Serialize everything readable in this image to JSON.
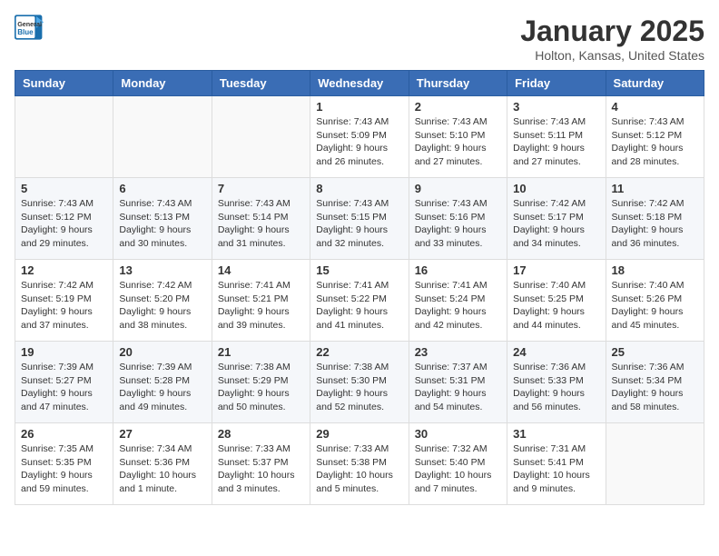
{
  "logo": {
    "line1": "General",
    "line2": "Blue"
  },
  "title": "January 2025",
  "subtitle": "Holton, Kansas, United States",
  "headers": [
    "Sunday",
    "Monday",
    "Tuesday",
    "Wednesday",
    "Thursday",
    "Friday",
    "Saturday"
  ],
  "weeks": [
    [
      {
        "day": "",
        "detail": ""
      },
      {
        "day": "",
        "detail": ""
      },
      {
        "day": "",
        "detail": ""
      },
      {
        "day": "1",
        "detail": "Sunrise: 7:43 AM\nSunset: 5:09 PM\nDaylight: 9 hours and 26 minutes."
      },
      {
        "day": "2",
        "detail": "Sunrise: 7:43 AM\nSunset: 5:10 PM\nDaylight: 9 hours and 27 minutes."
      },
      {
        "day": "3",
        "detail": "Sunrise: 7:43 AM\nSunset: 5:11 PM\nDaylight: 9 hours and 27 minutes."
      },
      {
        "day": "4",
        "detail": "Sunrise: 7:43 AM\nSunset: 5:12 PM\nDaylight: 9 hours and 28 minutes."
      }
    ],
    [
      {
        "day": "5",
        "detail": "Sunrise: 7:43 AM\nSunset: 5:12 PM\nDaylight: 9 hours and 29 minutes."
      },
      {
        "day": "6",
        "detail": "Sunrise: 7:43 AM\nSunset: 5:13 PM\nDaylight: 9 hours and 30 minutes."
      },
      {
        "day": "7",
        "detail": "Sunrise: 7:43 AM\nSunset: 5:14 PM\nDaylight: 9 hours and 31 minutes."
      },
      {
        "day": "8",
        "detail": "Sunrise: 7:43 AM\nSunset: 5:15 PM\nDaylight: 9 hours and 32 minutes."
      },
      {
        "day": "9",
        "detail": "Sunrise: 7:43 AM\nSunset: 5:16 PM\nDaylight: 9 hours and 33 minutes."
      },
      {
        "day": "10",
        "detail": "Sunrise: 7:42 AM\nSunset: 5:17 PM\nDaylight: 9 hours and 34 minutes."
      },
      {
        "day": "11",
        "detail": "Sunrise: 7:42 AM\nSunset: 5:18 PM\nDaylight: 9 hours and 36 minutes."
      }
    ],
    [
      {
        "day": "12",
        "detail": "Sunrise: 7:42 AM\nSunset: 5:19 PM\nDaylight: 9 hours and 37 minutes."
      },
      {
        "day": "13",
        "detail": "Sunrise: 7:42 AM\nSunset: 5:20 PM\nDaylight: 9 hours and 38 minutes."
      },
      {
        "day": "14",
        "detail": "Sunrise: 7:41 AM\nSunset: 5:21 PM\nDaylight: 9 hours and 39 minutes."
      },
      {
        "day": "15",
        "detail": "Sunrise: 7:41 AM\nSunset: 5:22 PM\nDaylight: 9 hours and 41 minutes."
      },
      {
        "day": "16",
        "detail": "Sunrise: 7:41 AM\nSunset: 5:24 PM\nDaylight: 9 hours and 42 minutes."
      },
      {
        "day": "17",
        "detail": "Sunrise: 7:40 AM\nSunset: 5:25 PM\nDaylight: 9 hours and 44 minutes."
      },
      {
        "day": "18",
        "detail": "Sunrise: 7:40 AM\nSunset: 5:26 PM\nDaylight: 9 hours and 45 minutes."
      }
    ],
    [
      {
        "day": "19",
        "detail": "Sunrise: 7:39 AM\nSunset: 5:27 PM\nDaylight: 9 hours and 47 minutes."
      },
      {
        "day": "20",
        "detail": "Sunrise: 7:39 AM\nSunset: 5:28 PM\nDaylight: 9 hours and 49 minutes."
      },
      {
        "day": "21",
        "detail": "Sunrise: 7:38 AM\nSunset: 5:29 PM\nDaylight: 9 hours and 50 minutes."
      },
      {
        "day": "22",
        "detail": "Sunrise: 7:38 AM\nSunset: 5:30 PM\nDaylight: 9 hours and 52 minutes."
      },
      {
        "day": "23",
        "detail": "Sunrise: 7:37 AM\nSunset: 5:31 PM\nDaylight: 9 hours and 54 minutes."
      },
      {
        "day": "24",
        "detail": "Sunrise: 7:36 AM\nSunset: 5:33 PM\nDaylight: 9 hours and 56 minutes."
      },
      {
        "day": "25",
        "detail": "Sunrise: 7:36 AM\nSunset: 5:34 PM\nDaylight: 9 hours and 58 minutes."
      }
    ],
    [
      {
        "day": "26",
        "detail": "Sunrise: 7:35 AM\nSunset: 5:35 PM\nDaylight: 9 hours and 59 minutes."
      },
      {
        "day": "27",
        "detail": "Sunrise: 7:34 AM\nSunset: 5:36 PM\nDaylight: 10 hours and 1 minute."
      },
      {
        "day": "28",
        "detail": "Sunrise: 7:33 AM\nSunset: 5:37 PM\nDaylight: 10 hours and 3 minutes."
      },
      {
        "day": "29",
        "detail": "Sunrise: 7:33 AM\nSunset: 5:38 PM\nDaylight: 10 hours and 5 minutes."
      },
      {
        "day": "30",
        "detail": "Sunrise: 7:32 AM\nSunset: 5:40 PM\nDaylight: 10 hours and 7 minutes."
      },
      {
        "day": "31",
        "detail": "Sunrise: 7:31 AM\nSunset: 5:41 PM\nDaylight: 10 hours and 9 minutes."
      },
      {
        "day": "",
        "detail": ""
      }
    ]
  ]
}
